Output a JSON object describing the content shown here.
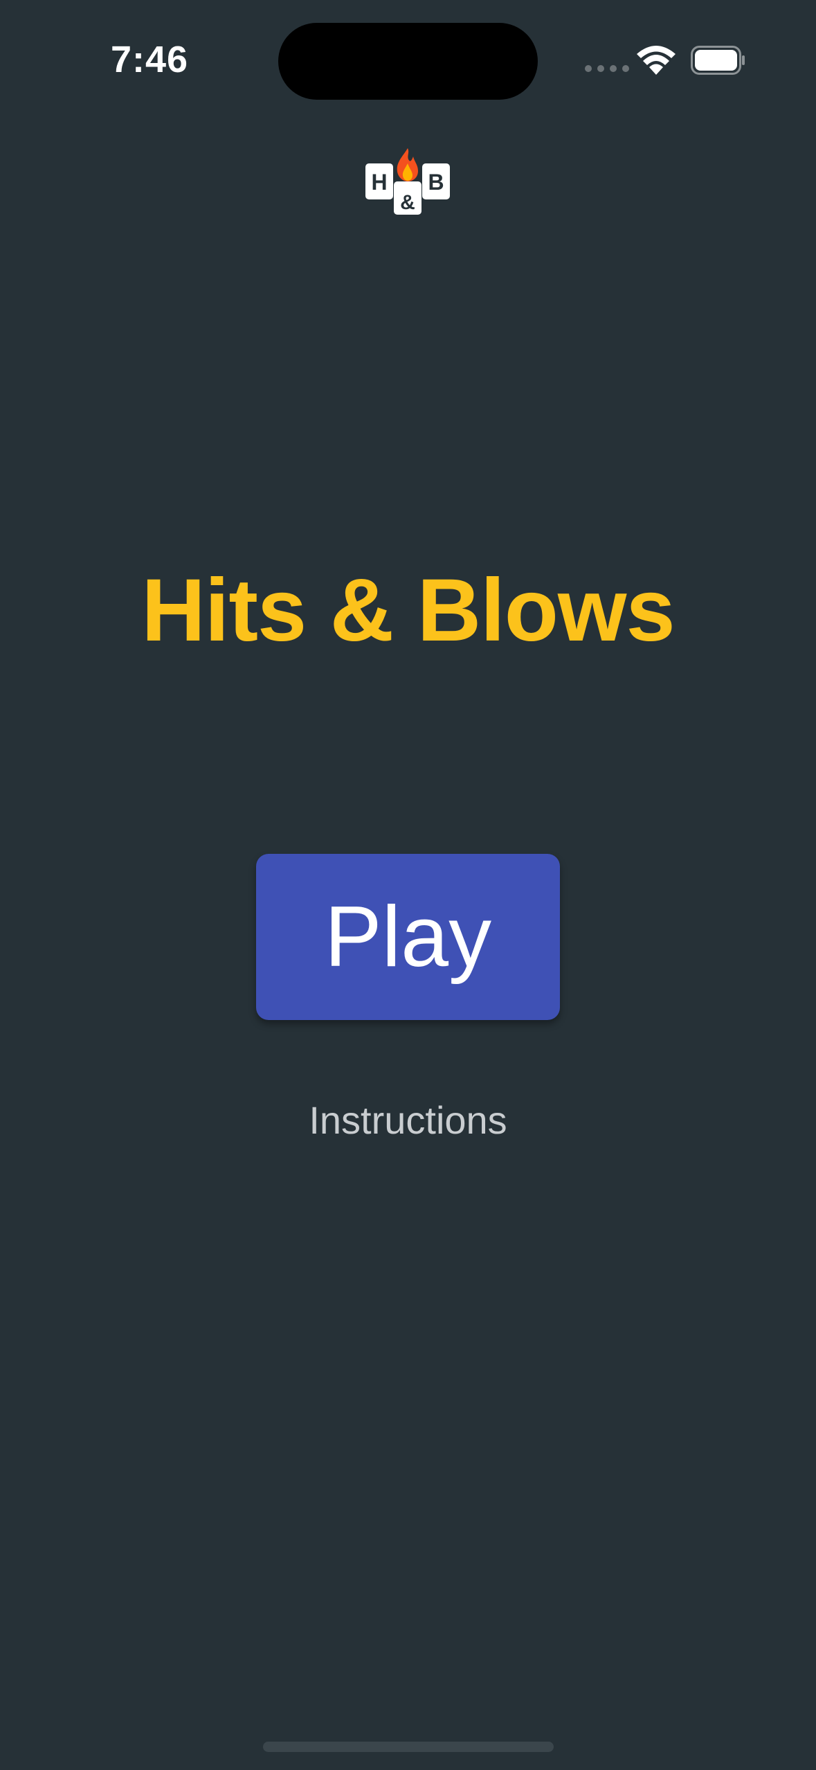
{
  "status_bar": {
    "time": "7:46"
  },
  "logo": {
    "letter_left": "H",
    "letter_middle": "&",
    "letter_right": "B",
    "icon": "fire-icon"
  },
  "title": "Hits & Blows",
  "play_label": "Play",
  "instructions_label": "Instructions",
  "colors": {
    "background": "#263137",
    "title": "#FCC21B",
    "play_button": "#3F51B5",
    "instructions_text": "#C9CDD0"
  }
}
